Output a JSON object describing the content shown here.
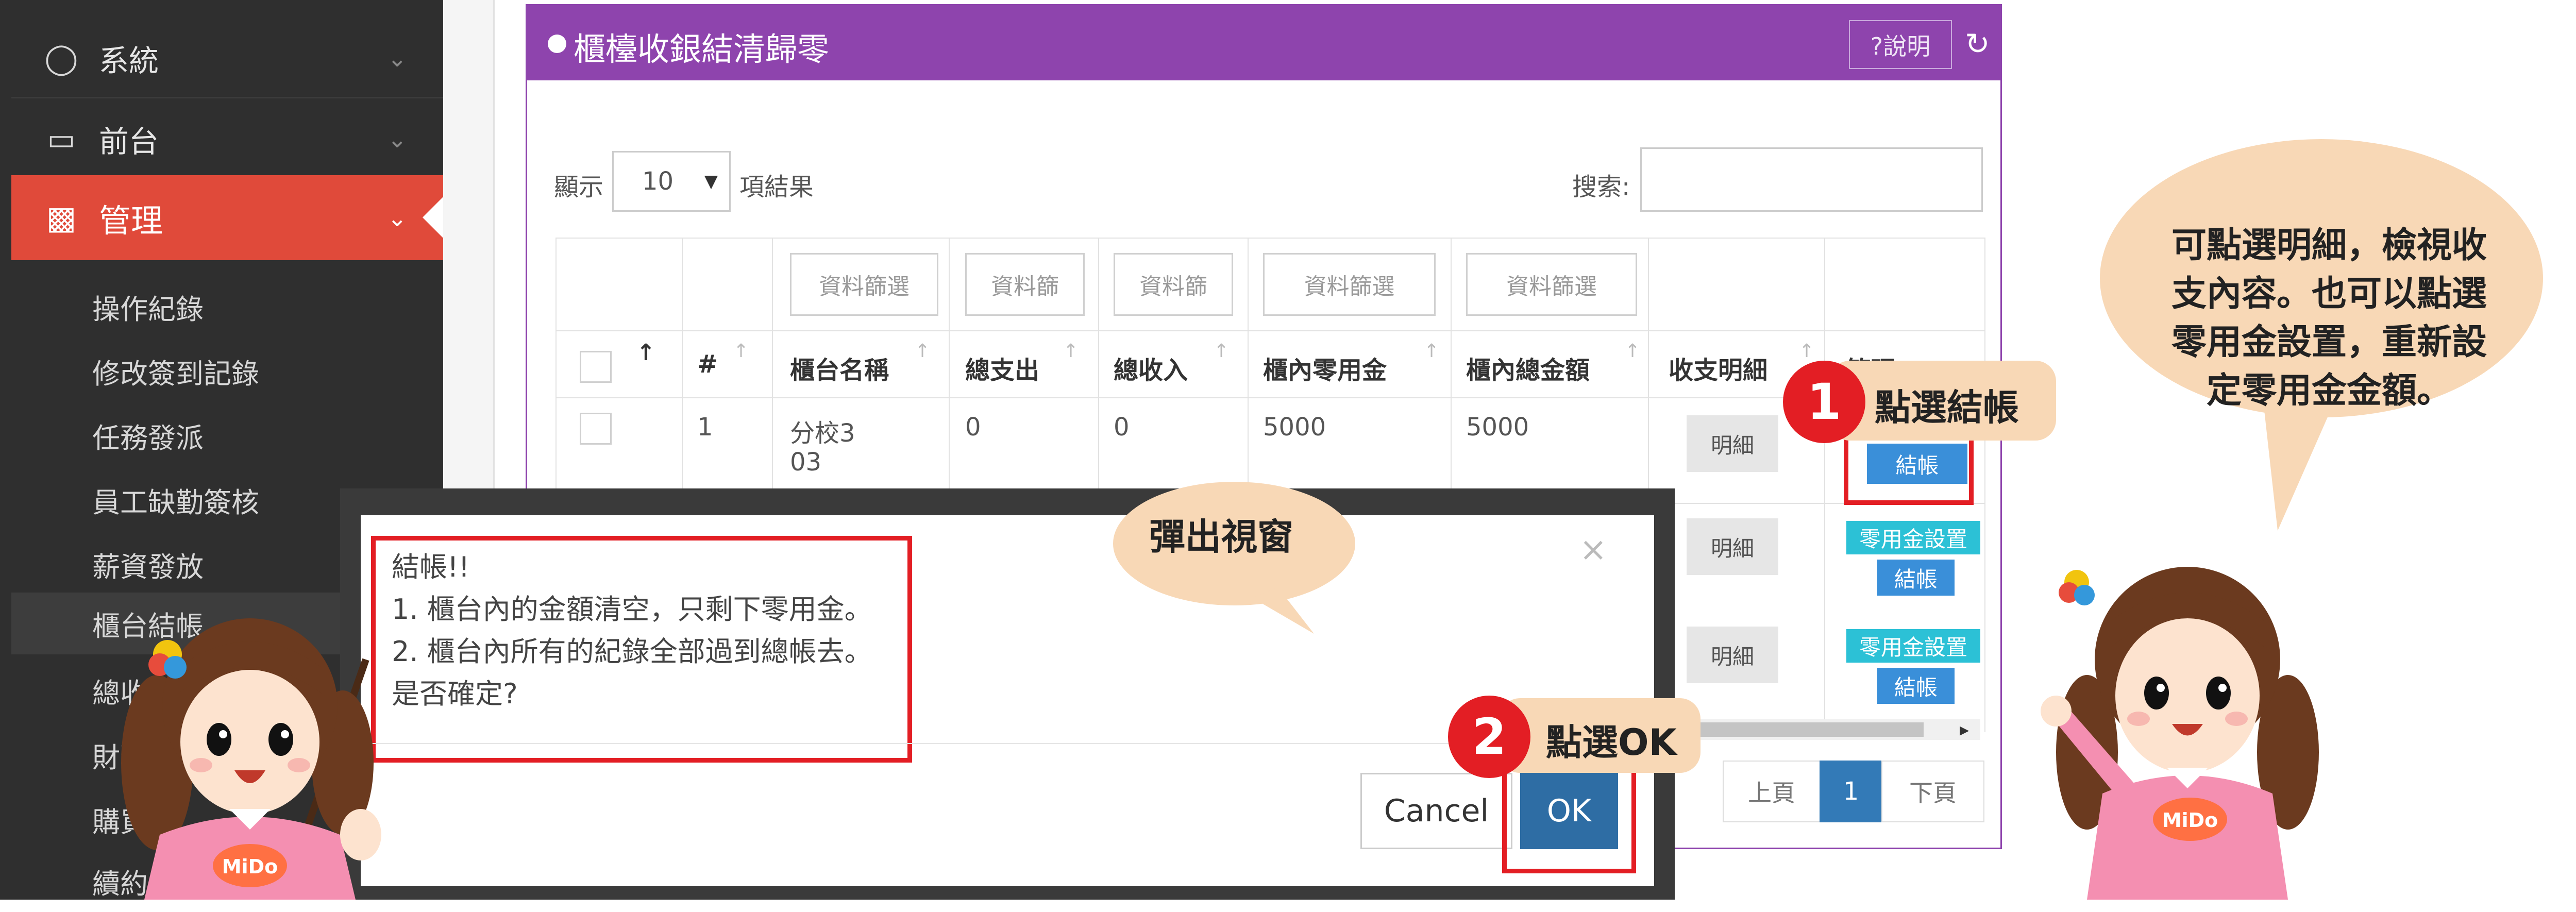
{
  "sidebar": {
    "sections": [
      {
        "label": "系統",
        "icon": "tag-icon"
      },
      {
        "label": "前台",
        "icon": "monitor-icon"
      }
    ],
    "active": {
      "label": "管理",
      "icon": "bar-chart-icon"
    },
    "sub_items": [
      "操作紀錄",
      "修改簽到記錄",
      "任務發派",
      "員工缺勤簽核",
      "薪資發放",
      "櫃台結帳",
      "總收",
      "財務",
      "購買",
      "續約"
    ]
  },
  "panel": {
    "title": "櫃檯收銀結清歸零",
    "help_label": "?說明",
    "show_label": "顯示",
    "page_size": "10",
    "results_label": "項結果",
    "search_label": "搜索:",
    "search_value": ""
  },
  "table": {
    "filters": [
      "資料篩選",
      "資料篩",
      "資料篩",
      "資料篩選",
      "資料篩選"
    ],
    "headers": [
      "#",
      "櫃台名稱",
      "總支出",
      "總收入",
      "櫃內零用金",
      "櫃內總金額",
      "收支明細",
      "管理"
    ],
    "rows": [
      {
        "num": "1",
        "name_line1": "分校3",
        "name_line2": "03",
        "expense": "0",
        "income": "0",
        "petty": "5000",
        "total": "5000",
        "detail": "明細"
      }
    ],
    "detail_label": "明細",
    "petty_setting_label": "零用金設置",
    "checkout_label": "結帳"
  },
  "pagination": {
    "prev": "上頁",
    "current": "1",
    "next": "下頁"
  },
  "dialog": {
    "lines": [
      "結帳!!",
      "1. 櫃台內的金額清空，只剩下零用金。",
      "2. 櫃台內所有的紀錄全部過到總帳去。",
      "是否確定?"
    ],
    "cancel_label": "Cancel",
    "ok_label": "OK",
    "close_symbol": "×"
  },
  "annotations": {
    "step1_number": "1",
    "step1_text": "點選結帳",
    "step2_number": "2",
    "step2_text": "點選OK",
    "popup_label": "彈出視窗",
    "tip_lines": [
      "可點選明細，檢視收",
      "支內容。也可以點選",
      "零用金設置，重新設",
      "定零用金金額。"
    ],
    "mascot_logo": "MiDo"
  },
  "colors": {
    "panel_header": "#8e44ad",
    "sidebar_active": "#e04a3a",
    "annotation_red": "#e31e24",
    "ok_button": "#2e6da4",
    "speech_bubble": "#f8d8b6"
  }
}
